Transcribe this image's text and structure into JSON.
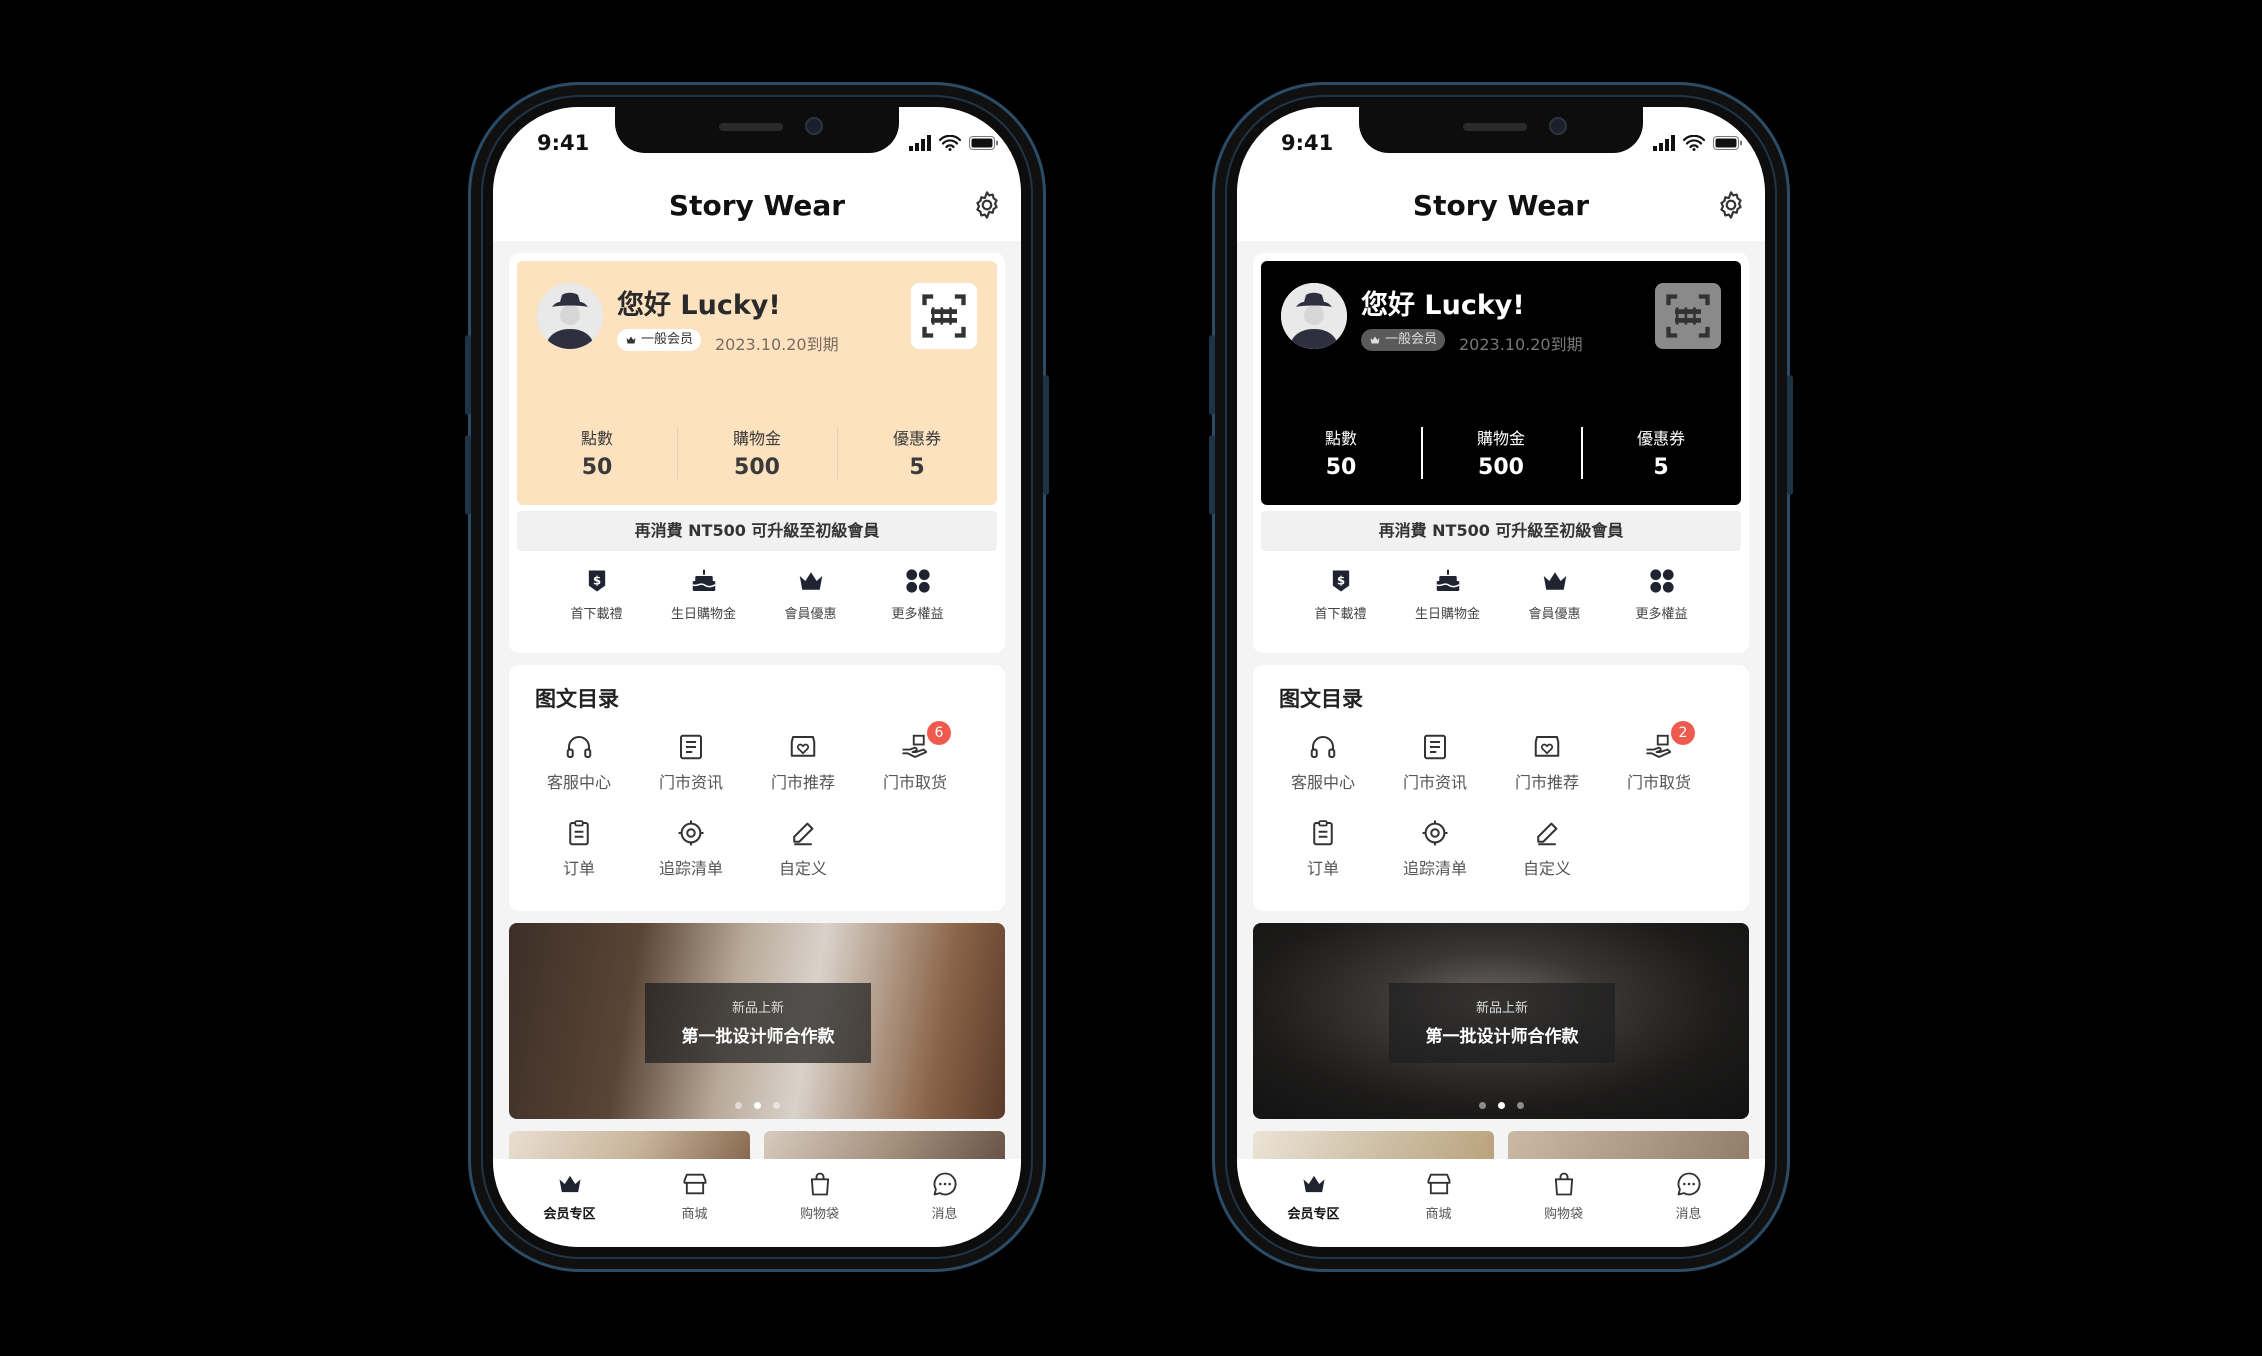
{
  "phones": [
    {
      "status": {
        "time": "9:41"
      },
      "header": {
        "title": "Story Wear"
      },
      "member": {
        "greeting": "您好 Lucky!",
        "tier": "一般会员",
        "expiry": "2023.10.20到期",
        "theme": "peach",
        "card_color": "#fde2bf",
        "stats": [
          {
            "label": "點數",
            "value": "50"
          },
          {
            "label": "購物金",
            "value": "500"
          },
          {
            "label": "優惠券",
            "value": "5"
          }
        ],
        "upgrade": "再消費 NT500 可升級至初級會員"
      },
      "perks": [
        {
          "label": "首下載禮",
          "icon": "shield-dollar-icon"
        },
        {
          "label": "生日購物金",
          "icon": "birthday-cake-icon"
        },
        {
          "label": "會員優惠",
          "icon": "crown-icon"
        },
        {
          "label": "更多權益",
          "icon": "four-dots-icon"
        }
      ],
      "catalog": {
        "title": "图文目录",
        "items": [
          {
            "label": "客服中心",
            "icon": "headset-icon"
          },
          {
            "label": "门市资讯",
            "icon": "document-icon"
          },
          {
            "label": "门市推荐",
            "icon": "store-heart-icon"
          },
          {
            "label": "门市取货",
            "icon": "hand-package-icon",
            "badge": "6"
          },
          {
            "label": "订单",
            "icon": "clipboard-icon"
          },
          {
            "label": "追踪清单",
            "icon": "target-icon"
          },
          {
            "label": "自定义",
            "icon": "pencil-icon"
          }
        ]
      },
      "banner": {
        "subtitle": "新品上新",
        "title": "第一批设计师合作款",
        "active_dot": 1
      },
      "tabs": [
        {
          "label": "会员专区",
          "icon": "crown-icon",
          "active": true
        },
        {
          "label": "商城",
          "icon": "shop-icon",
          "active": false
        },
        {
          "label": "购物袋",
          "icon": "shopping-bag-icon",
          "active": false
        },
        {
          "label": "消息",
          "icon": "chat-bubble-icon",
          "active": false
        }
      ]
    },
    {
      "status": {
        "time": "9:41"
      },
      "header": {
        "title": "Story Wear"
      },
      "member": {
        "greeting": "您好 Lucky!",
        "tier": "一般会员",
        "expiry": "2023.10.20到期",
        "theme": "black",
        "card_color": "#000000",
        "stats": [
          {
            "label": "點數",
            "value": "50"
          },
          {
            "label": "購物金",
            "value": "500"
          },
          {
            "label": "優惠券",
            "value": "5"
          }
        ],
        "upgrade": "再消費 NT500 可升級至初級會員"
      },
      "perks": [
        {
          "label": "首下載禮",
          "icon": "shield-dollar-icon"
        },
        {
          "label": "生日購物金",
          "icon": "birthday-cake-icon"
        },
        {
          "label": "會員優惠",
          "icon": "crown-icon"
        },
        {
          "label": "更多權益",
          "icon": "four-dots-icon"
        }
      ],
      "catalog": {
        "title": "图文目录",
        "items": [
          {
            "label": "客服中心",
            "icon": "headset-icon"
          },
          {
            "label": "门市资讯",
            "icon": "document-icon"
          },
          {
            "label": "门市推荐",
            "icon": "store-heart-icon"
          },
          {
            "label": "门市取货",
            "icon": "hand-package-icon",
            "badge": "2"
          },
          {
            "label": "订单",
            "icon": "clipboard-icon"
          },
          {
            "label": "追踪清单",
            "icon": "target-icon"
          },
          {
            "label": "自定义",
            "icon": "pencil-icon"
          }
        ]
      },
      "banner": {
        "subtitle": "新品上新",
        "title": "第一批设计师合作款",
        "active_dot": 1
      },
      "tabs": [
        {
          "label": "会员专区",
          "icon": "crown-icon",
          "active": true
        },
        {
          "label": "商城",
          "icon": "shop-icon",
          "active": false
        },
        {
          "label": "购物袋",
          "icon": "shopping-bag-icon",
          "active": false
        },
        {
          "label": "消息",
          "icon": "chat-bubble-icon",
          "active": false
        }
      ]
    }
  ],
  "colors": {
    "badge_red": "#ef5a4f",
    "peach": "#fde2bf",
    "dark": "#000000"
  }
}
